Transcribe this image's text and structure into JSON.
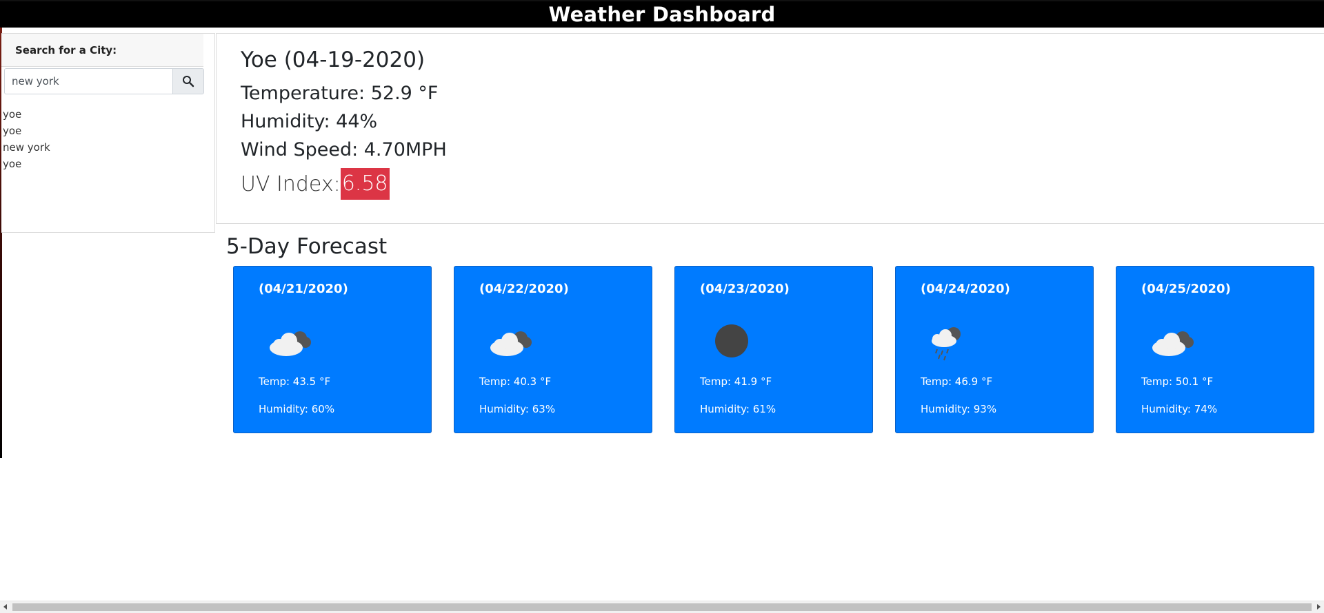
{
  "header": {
    "title": "Weather Dashboard"
  },
  "sidebar": {
    "label": "Search for a City:",
    "search": {
      "value": "new york",
      "placeholder": "",
      "button_icon": "magnifier-icon"
    },
    "history": [
      "yoe",
      "yoe",
      "new york",
      "yoe"
    ]
  },
  "current": {
    "city_date": "Yoe (04-19-2020)",
    "temperature": "Temperature: 52.9 °F",
    "humidity": "Humidity: 44%",
    "wind": "Wind Speed: 4.70MPH",
    "uv_label": "UV Index:",
    "uv_value": "6.58",
    "uv_color": "#dc3545"
  },
  "forecast": {
    "title": "5-Day Forecast",
    "card_color": "#007bff",
    "days": [
      {
        "date": "(04/21/2020)",
        "icon": "cloud-icon",
        "temp": "Temp: 43.5 °F",
        "humidity": "Humidity: 60%"
      },
      {
        "date": "(04/22/2020)",
        "icon": "cloud-icon",
        "temp": "Temp: 40.3 °F",
        "humidity": "Humidity: 63%"
      },
      {
        "date": "(04/23/2020)",
        "icon": "dark-circle-icon",
        "temp": "Temp: 41.9 °F",
        "humidity": "Humidity: 61%"
      },
      {
        "date": "(04/24/2020)",
        "icon": "rain-cloud-icon",
        "temp": "Temp: 46.9 °F",
        "humidity": "Humidity: 93%"
      },
      {
        "date": "(04/25/2020)",
        "icon": "cloud-icon",
        "temp": "Temp: 50.1 °F",
        "humidity": "Humidity: 74%"
      }
    ]
  }
}
